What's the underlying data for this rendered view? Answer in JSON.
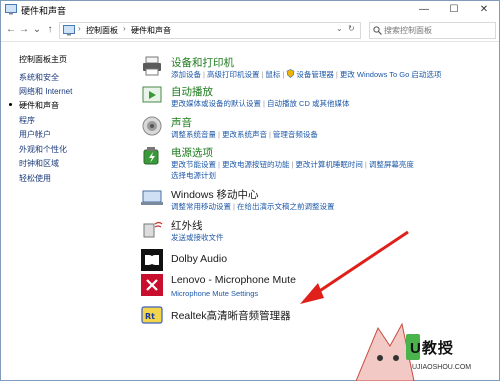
{
  "window": {
    "title": "硬件和声音",
    "buttons": {
      "minimize": "—",
      "maximize": "☐",
      "close": "✕"
    }
  },
  "addressbar": {
    "back": "←",
    "forward": "→",
    "dropdown": "⌄",
    "up": "↑",
    "crumbs": [
      "控制面板",
      "硬件和声音"
    ],
    "separator": "›",
    "refresh": "↻",
    "search_placeholder": "搜索控制面板"
  },
  "sidebar": {
    "home": "控制面板主页",
    "items": [
      {
        "label": "系统和安全"
      },
      {
        "label": "网络和 Internet"
      },
      {
        "label": "硬件和声音",
        "current": true
      },
      {
        "label": "程序"
      },
      {
        "label": "用户帐户"
      },
      {
        "label": "外观和个性化"
      },
      {
        "label": "时钟和区域"
      },
      {
        "label": "轻松使用"
      }
    ]
  },
  "categories": [
    {
      "icon": "printer-icon",
      "title": "设备和打印机",
      "links": [
        "添加设备",
        "高级打印机设置",
        "鼠标",
        "设备管理器",
        "更改 Windows To Go 启动选项"
      ]
    },
    {
      "icon": "autoplay-icon",
      "title": "自动播放",
      "links": [
        "更改媒体或设备的默认设置",
        "自动播放 CD 或其他媒体"
      ]
    },
    {
      "icon": "speaker-icon",
      "title": "声音",
      "links": [
        "调整系统音量",
        "更改系统声音",
        "管理音频设备"
      ]
    },
    {
      "icon": "battery-icon",
      "title": "电源选项",
      "links": [
        "更改节能设置",
        "更改电源按钮的功能",
        "更改计算机睡眠时间",
        "调整屏幕亮度",
        "选择电源计划"
      ]
    },
    {
      "icon": "mobility-center-icon",
      "title": "Windows 移动中心",
      "links": [
        "调整常用移动设置",
        "在给出演示文稿之前调整设置"
      ]
    },
    {
      "icon": "infrared-icon",
      "title": "红外线",
      "links": [
        "发送或接收文件"
      ]
    },
    {
      "icon": "dolby-icon",
      "title": "Dolby Audio",
      "links": []
    },
    {
      "icon": "mic-mute-icon",
      "title": "Lenovo - Microphone Mute",
      "links": [
        "Microphone Mute Settings"
      ]
    },
    {
      "icon": "realtek-icon",
      "title": "Realtek高清晰音频管理器",
      "links": []
    }
  ],
  "watermark": {
    "text": "U教授",
    "url": "UJIAOSHOU.COM"
  },
  "colors": {
    "link": "#1e5aa8",
    "category_title": "#1e7b1e",
    "annotation": "#e0201a"
  }
}
